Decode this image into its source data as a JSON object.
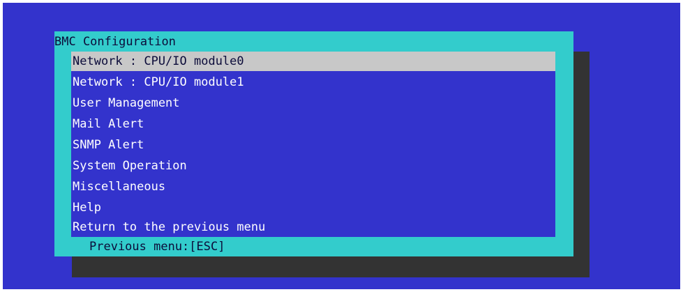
{
  "dialog": {
    "title": "BMC Configuration",
    "hint": "Previous menu:[ESC]"
  },
  "menu": {
    "items": [
      {
        "label": "Network : CPU/IO module0",
        "selected": true
      },
      {
        "label": "Network : CPU/IO module1",
        "selected": false
      },
      {
        "label": "User Management",
        "selected": false
      },
      {
        "label": "Mail Alert",
        "selected": false
      },
      {
        "label": "SNMP Alert",
        "selected": false
      },
      {
        "label": "System Operation",
        "selected": false
      },
      {
        "label": "Miscellaneous",
        "selected": false
      },
      {
        "label": "Help",
        "selected": false
      },
      {
        "label": "Return to the previous menu",
        "selected": false
      }
    ]
  },
  "colors": {
    "background": "#3333cc",
    "dialog": "#33cccc",
    "shadow": "#333333",
    "selection": "#c8c8c8",
    "text": "#ffffff"
  }
}
